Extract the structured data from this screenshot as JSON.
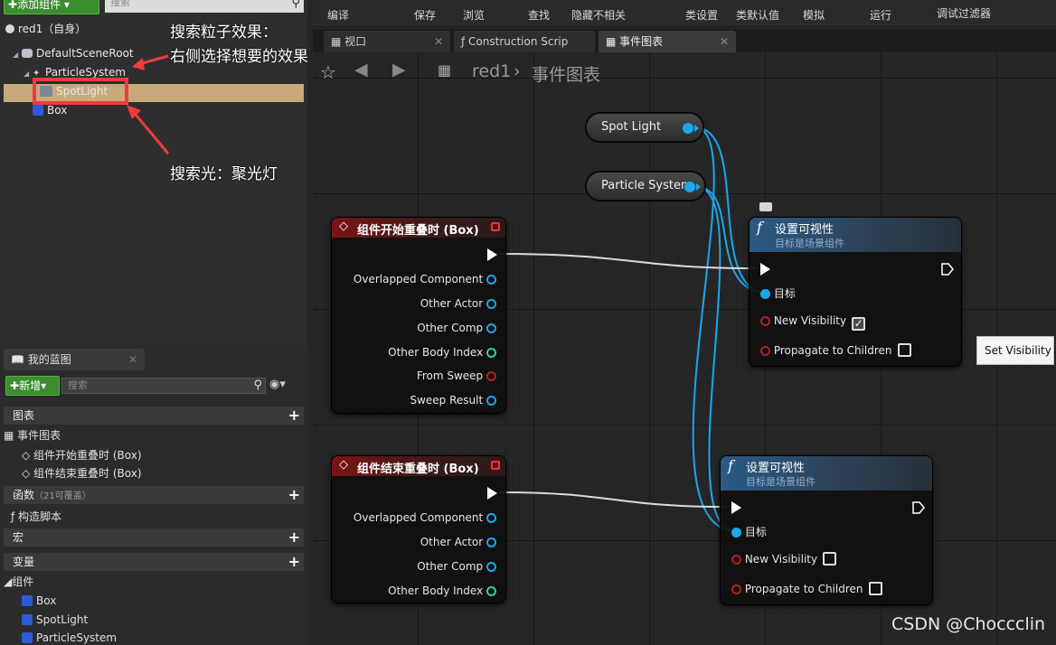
{
  "components_panel": {
    "add_button": "添加组件",
    "search_placeholder": "搜索",
    "root": "red1（自身）",
    "tree": [
      "DefaultSceneRoot",
      "ParticleSystem",
      "SpotLight",
      "Box"
    ]
  },
  "annotations": {
    "particle_line1": "搜索粒子效果：",
    "particle_line2": "右侧选择想要的效果",
    "light_line": "搜索光：聚光灯"
  },
  "blueprint_panel": {
    "tab": "我的蓝图",
    "new_button": "新增",
    "search_placeholder": "搜索",
    "sections": {
      "graphs": "图表",
      "event_graph": "事件图表",
      "begin_overlap": "组件开始重叠时 (Box)",
      "end_overlap": "组件结束重叠时 (Box)",
      "functions": "函数",
      "functions_sub": "（21可覆盖）",
      "construction": "构造脚本",
      "macros": "宏",
      "variables": "变量",
      "components": "组件",
      "comp_items": [
        "Box",
        "SpotLight",
        "ParticleSystem"
      ]
    }
  },
  "toolbar": {
    "compile": "编译",
    "save": "保存",
    "browse": "浏览",
    "find": "查找",
    "hide_unrelated": "隐藏不相关",
    "class_settings": "类设置",
    "class_defaults": "类默认值",
    "simulate": "模拟",
    "play": "运行",
    "debug_filter": "调试过滤器"
  },
  "tabs": {
    "viewport": "视口",
    "construction": "Construction Scrip",
    "event_graph": "事件图表"
  },
  "breadcrumb": {
    "root": "red1",
    "sep": "›",
    "current": "事件图表"
  },
  "graph": {
    "getters": {
      "spot": "Spot Light",
      "particle": "Particle System"
    },
    "event1": {
      "title": "组件开始重叠时 (Box)",
      "pins": [
        "Overlapped Component",
        "Other Actor",
        "Other Comp",
        "Other Body Index",
        "From Sweep",
        "Sweep Result"
      ]
    },
    "event2": {
      "title": "组件结束重叠时 (Box)",
      "pins": [
        "Overlapped Component",
        "Other Actor",
        "Other Comp",
        "Other Body Index"
      ]
    },
    "fn1": {
      "title": "设置可视性",
      "subtitle": "目标是场景组件",
      "target": "目标",
      "new_vis": "New Visibility",
      "new_vis_checked": true,
      "propagate": "Propagate to Children"
    },
    "fn2": {
      "title": "设置可视性",
      "subtitle": "目标是场景组件",
      "target": "目标",
      "new_vis": "New Visibility",
      "new_vis_checked": false,
      "propagate": "Propagate to Children"
    },
    "tooltip": "Set Visibility"
  },
  "watermark": "CSDN @Choccclin",
  "colors": {
    "wire_blue": "#1aa7ec",
    "event_red": "#7a1414",
    "fn_blue": "#2b5a86",
    "annotation_red": "#ee3b3b"
  }
}
